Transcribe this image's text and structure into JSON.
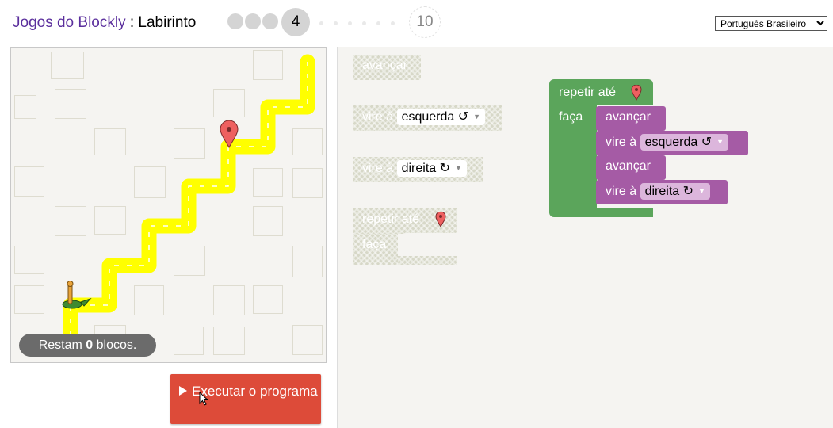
{
  "header": {
    "app_name": "Jogos do Blockly",
    "separator": " : ",
    "game_name": "Labirinto",
    "current_level": "4",
    "last_level": "10"
  },
  "language": {
    "selected": "Português Brasileiro"
  },
  "maze": {
    "status_prefix": "Restam ",
    "status_count": "0",
    "status_suffix": " blocos."
  },
  "run_button": {
    "label": "Executar o programa"
  },
  "toolbox": {
    "forward": "avançar",
    "turn_label": "vire à",
    "turn_left": "esquerda ↺",
    "turn_right": "direita ↻",
    "repeat_until": "repetir até",
    "do_label": "faça"
  },
  "workspace": {
    "repeat_until": "repetir até",
    "do_label": "faça",
    "stmt1": "avançar",
    "stmt2_label": "vire à",
    "stmt2_dir": "esquerda ↺",
    "stmt3": "avançar",
    "stmt4_label": "vire à",
    "stmt4_dir": "direita ↻"
  },
  "colors": {
    "path": "#ffff00",
    "loop_block": "#5ba55b",
    "action_block": "#a55ba5",
    "run_button": "#dd4b39",
    "title_link": "#5b2f9d"
  }
}
